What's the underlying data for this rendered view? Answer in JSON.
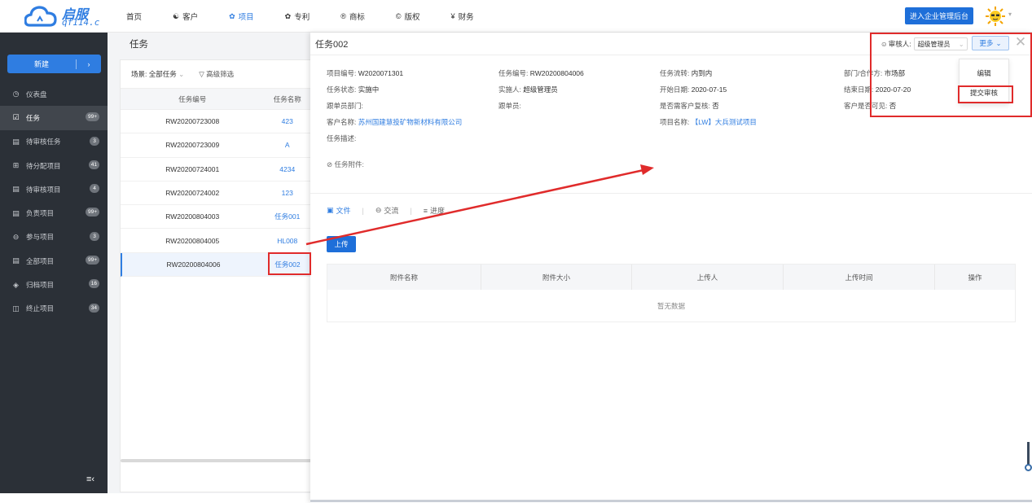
{
  "brand": {
    "name": "启服",
    "domain": "qf114.c"
  },
  "nav": [
    {
      "label": "首页",
      "icon": ""
    },
    {
      "label": "客户",
      "icon": "user-group-icon"
    },
    {
      "label": "项目",
      "icon": "project-icon"
    },
    {
      "label": "专利",
      "icon": "patent-icon"
    },
    {
      "label": "商标",
      "icon": "trademark-icon"
    },
    {
      "label": "版权",
      "icon": "copyright-icon"
    },
    {
      "label": "财务",
      "icon": "finance-icon"
    }
  ],
  "header": {
    "admin_label": "进入企业管理后台"
  },
  "sidebar": {
    "new_label": "新建",
    "items": [
      {
        "label": "仪表盘",
        "badge": "",
        "icon": "dashboard-icon"
      },
      {
        "label": "任务",
        "badge": "99+",
        "icon": "task-icon"
      },
      {
        "label": "待审核任务",
        "badge": "3",
        "icon": "pending-review-task-icon"
      },
      {
        "label": "待分配项目",
        "badge": "41",
        "icon": "assign-project-icon"
      },
      {
        "label": "待审核项目",
        "badge": "4",
        "icon": "pending-review-project-icon"
      },
      {
        "label": "负责项目",
        "badge": "99+",
        "icon": "responsible-project-icon"
      },
      {
        "label": "参与项目",
        "badge": "3",
        "icon": "participate-project-icon"
      },
      {
        "label": "全部项目",
        "badge": "99+",
        "icon": "all-projects-icon"
      },
      {
        "label": "归档项目",
        "badge": "16",
        "icon": "archive-icon"
      },
      {
        "label": "终止项目",
        "badge": "34",
        "icon": "trash-icon"
      }
    ]
  },
  "list": {
    "title": "任务",
    "scene_label": "场景: 全部任务",
    "filter_label": "高级筛选",
    "columns": {
      "code": "任务编号",
      "name": "任务名称"
    },
    "rows": [
      {
        "code": "RW20200723008",
        "name": "423"
      },
      {
        "code": "RW20200723009",
        "name": "A"
      },
      {
        "code": "RW20200724001",
        "name": "4234"
      },
      {
        "code": "RW20200724002",
        "name": "123"
      },
      {
        "code": "RW20200804003",
        "name": "任务001"
      },
      {
        "code": "RW20200804005",
        "name": "HL008"
      },
      {
        "code": "RW20200804006",
        "name": "任务002"
      }
    ]
  },
  "detail": {
    "title": "任务002",
    "approver_label": "审核人:",
    "approver_value": "超级管理员",
    "more_label": "更多",
    "menu": {
      "edit": "编辑",
      "submit": "提交审核"
    },
    "fields": {
      "project_no": {
        "label": "项目编号:",
        "value": "W2020071301"
      },
      "task_no": {
        "label": "任务编号:",
        "value": "RW20200804006"
      },
      "task_flow": {
        "label": "任务流转:",
        "value": "内到内"
      },
      "dept": {
        "label": "部门/合作方:",
        "value": "市场部"
      },
      "status": {
        "label": "任务状态:",
        "value": "实施中"
      },
      "implementer": {
        "label": "实施人:",
        "value": "超级管理员"
      },
      "start": {
        "label": "开始日期:",
        "value": "2020-07-15"
      },
      "end": {
        "label": "结束日期:",
        "value": "2020-07-20"
      },
      "follow_dept": {
        "label": "跟单员部门:",
        "value": ""
      },
      "follower": {
        "label": "跟单员:",
        "value": ""
      },
      "need_review": {
        "label": "是否需客户复核:",
        "value": "否"
      },
      "visible": {
        "label": "客户是否可见:",
        "value": "否"
      },
      "customer": {
        "label": "客户名称:",
        "value": "苏州国建慧投矿物新材料有限公司"
      },
      "project_name": {
        "label": "项目名称:",
        "value": "【LW】大兵测试项目"
      },
      "desc": {
        "label": "任务描述:",
        "value": ""
      }
    },
    "attachments_label": "任务附件:",
    "tabs": [
      "文件",
      "交流",
      "进度"
    ],
    "upload_label": "上传",
    "table_columns": [
      "附件名称",
      "附件大小",
      "上传人",
      "上传时间",
      "操作"
    ],
    "empty_text": "暂无数据"
  },
  "colors": {
    "accent": "#2f7de1",
    "sidebar_bg": "#2b3037",
    "annotation": "#e02b2b"
  }
}
